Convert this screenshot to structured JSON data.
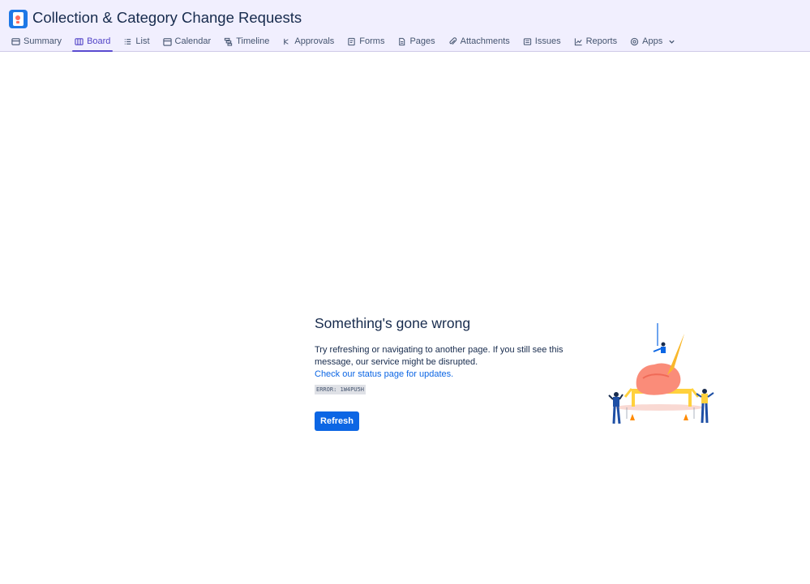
{
  "project": {
    "title": "Collection & Category Change Requests",
    "icon": "phone-app-icon"
  },
  "tabs": [
    {
      "label": "Summary",
      "icon": "summary-icon"
    },
    {
      "label": "Board",
      "icon": "board-icon",
      "active": true
    },
    {
      "label": "List",
      "icon": "list-icon"
    },
    {
      "label": "Calendar",
      "icon": "calendar-icon"
    },
    {
      "label": "Timeline",
      "icon": "timeline-icon"
    },
    {
      "label": "Approvals",
      "icon": "approvals-icon"
    },
    {
      "label": "Forms",
      "icon": "forms-icon"
    },
    {
      "label": "Pages",
      "icon": "pages-icon"
    },
    {
      "label": "Attachments",
      "icon": "paperclip-icon"
    },
    {
      "label": "Issues",
      "icon": "issues-icon"
    },
    {
      "label": "Reports",
      "icon": "reports-icon"
    },
    {
      "label": "Apps",
      "icon": "apps-icon"
    }
  ],
  "error": {
    "heading": "Something's gone wrong",
    "message": "Try refreshing or navigating to another page. If you still see this message, our service might be disrupted.",
    "status_link": "Check our status page for updates.",
    "code": "ERROR: 1W4PU5H",
    "refresh_label": "Refresh"
  },
  "colors": {
    "accent": "#5a4bd0",
    "primary_button": "#0c66e4",
    "header_bg": "#f1effe"
  }
}
